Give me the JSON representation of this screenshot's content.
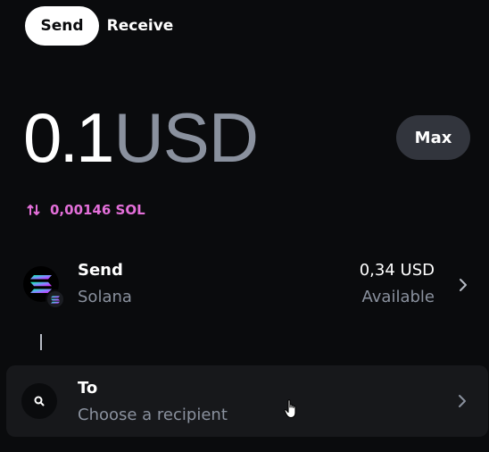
{
  "tabs": [
    {
      "label": "Send",
      "active": true
    },
    {
      "label": "Receive",
      "active": false
    }
  ],
  "amount": {
    "value": "0.1",
    "unit": "USD"
  },
  "max_button": {
    "label": "Max"
  },
  "conversion": {
    "icon": "swap-arrows-icon",
    "text": "0,00146 SOL",
    "color": "#e36fd9"
  },
  "asset": {
    "title": "Send",
    "network": "Solana",
    "balance": "0,34 USD",
    "balance_caption": "Available",
    "icon": "solana-icon"
  },
  "recipient": {
    "title": "To",
    "placeholder": "Choose a recipient",
    "icon": "search-icon"
  },
  "colors": {
    "background": "#0a0b0d",
    "secondary_text": "#8a919e",
    "row_background": "#17181b",
    "max_button_background": "#32353d"
  }
}
